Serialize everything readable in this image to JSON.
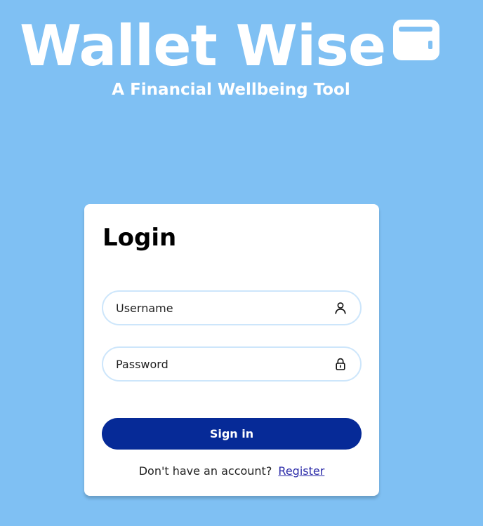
{
  "brand": {
    "title": "Wallet Wise",
    "subtitle": "A Financial Wellbeing Tool",
    "icon": "wallet-icon"
  },
  "login": {
    "heading": "Login",
    "username": {
      "placeholder": "Username",
      "value": "",
      "icon": "user-icon"
    },
    "password": {
      "placeholder": "Password",
      "value": "",
      "icon": "lock-icon"
    },
    "submit_label": "Sign in",
    "register_prompt": "Don't have an account?",
    "register_link": "Register"
  },
  "colors": {
    "background": "#7fc0f3",
    "card": "#ffffff",
    "button": "#062a97",
    "field_border": "#cde6fb",
    "link": "#2a2aa8"
  }
}
